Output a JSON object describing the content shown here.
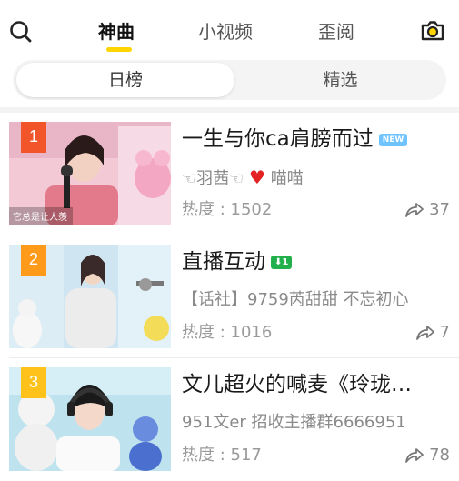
{
  "header": {
    "tabs": [
      {
        "label": "神曲",
        "active": true
      },
      {
        "label": "小视频",
        "active": false
      },
      {
        "label": "歪阅",
        "active": false
      }
    ],
    "accent_color": "#ffd400"
  },
  "segment": {
    "options": [
      "日榜",
      "精选"
    ],
    "selected": "日榜"
  },
  "list": [
    {
      "rank": "1",
      "rank_color": "#f3552a",
      "title": "一生与你ca肩膀而过",
      "badge": "NEW",
      "author_pre": "☜羽茜☜",
      "author_post": "喵喵",
      "heat": "热度 : 1502",
      "shares": "37",
      "thumb_caption": "它总是让人羡"
    },
    {
      "rank": "2",
      "rank_color": "#ff9a1a",
      "title": "直播互动",
      "badge": "1",
      "author": "【话社】9759芮甜甜 不忘初心",
      "heat": "热度 : 1016",
      "shares": "7"
    },
    {
      "rank": "3",
      "rank_color": "#ffc21a",
      "title": "文儿超火的喊麦《玲珑…",
      "author": "951文er 招收主播群6666951",
      "heat": "热度 : 517",
      "shares": "78"
    }
  ]
}
